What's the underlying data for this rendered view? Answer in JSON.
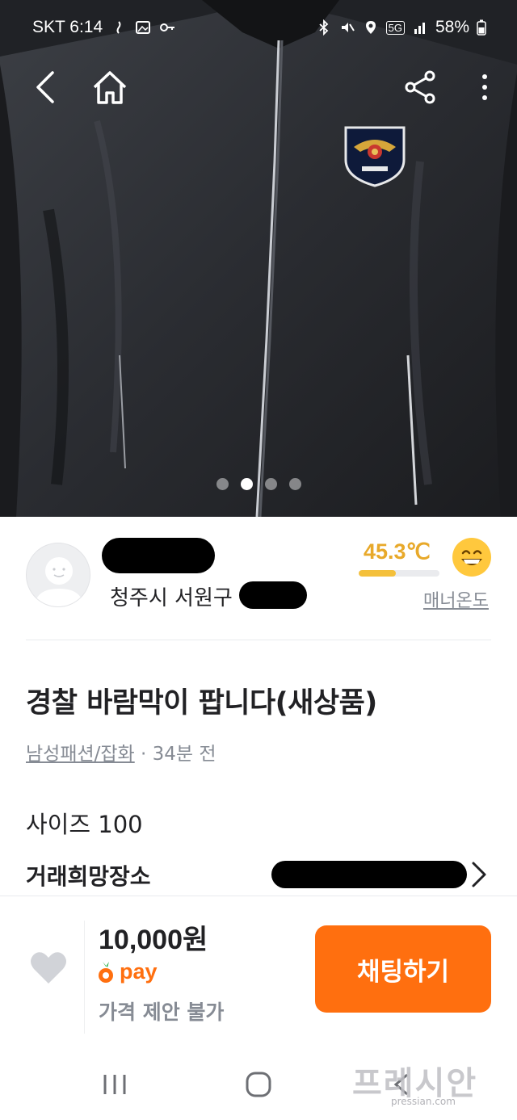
{
  "status_bar": {
    "carrier_time": "SKT 6:14",
    "battery": "58%",
    "network": "5G"
  },
  "top_nav": {
    "icons": [
      "back-icon",
      "home-icon",
      "share-icon",
      "more-vertical-icon"
    ]
  },
  "image_carousel": {
    "total": 4,
    "active_index": 1
  },
  "seller": {
    "location": "청주시 서원구",
    "manner_temp": "45.3℃",
    "manner_temp_value": 45.3,
    "manner_label": "매너온도"
  },
  "post": {
    "title": "경찰 바람막이 팝니다(새상품)",
    "category": "남성패션/잡화",
    "time_ago": " · 34분 전",
    "body": "사이즈 100",
    "place_label": "거래희망장소"
  },
  "bottom_bar": {
    "price": "10,000원",
    "pay_label": "pay",
    "price_note": "가격 제안 불가",
    "chat_button": "채팅하기"
  },
  "watermark": {
    "brand": "프레시안",
    "url": "pressian.com"
  },
  "colors": {
    "accent": "#ff6f0f",
    "temp": "#e8a92a",
    "muted": "#868b94"
  }
}
